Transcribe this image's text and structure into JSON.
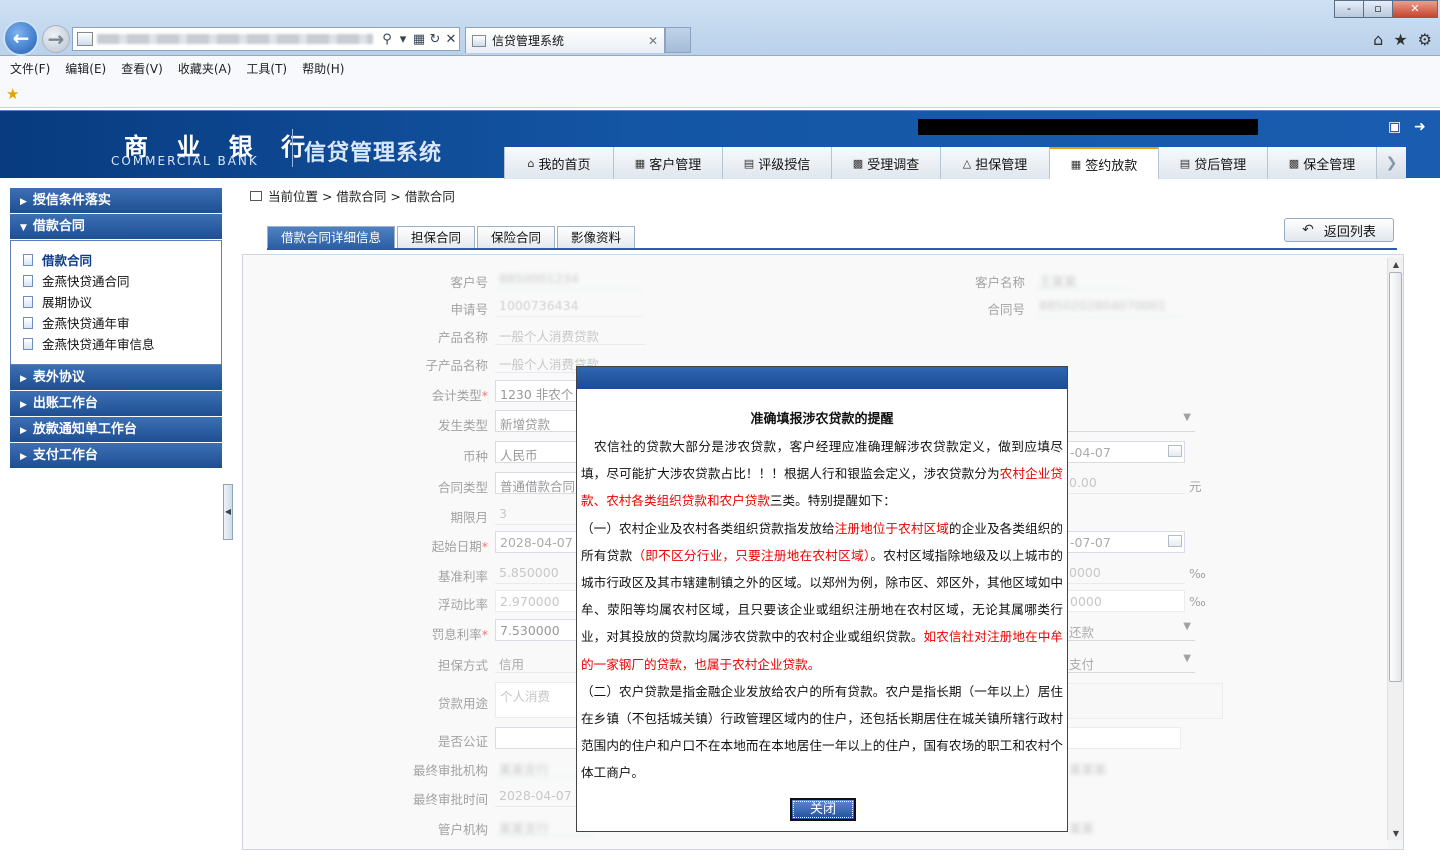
{
  "browser": {
    "tab_title": "信贷管理系统",
    "window_controls": [
      "-",
      "▫",
      "✕"
    ],
    "menu": [
      "文件(F)",
      "编辑(E)",
      "查看(V)",
      "收藏夹(A)",
      "工具(T)",
      "帮助(H)"
    ]
  },
  "header": {
    "bank_name_cn": "商 业 银 行",
    "bank_name_en": "COMMERCIAL BANK",
    "system_title": "信贷管理系统",
    "nav_tabs": [
      {
        "label": "我的首页",
        "icon": "home-icon"
      },
      {
        "label": "客户管理",
        "icon": "customer-icon"
      },
      {
        "label": "评级授信",
        "icon": "rating-icon"
      },
      {
        "label": "受理调查",
        "icon": "survey-icon"
      },
      {
        "label": "担保管理",
        "icon": "warning-icon"
      },
      {
        "label": "签约放款",
        "icon": "contract-icon",
        "active": true
      },
      {
        "label": "贷后管理",
        "icon": "postloan-icon"
      },
      {
        "label": "保全管理",
        "icon": "preserve-icon"
      }
    ]
  },
  "sidebar": {
    "groups": [
      {
        "label": "授信条件落实"
      },
      {
        "label": "借款合同",
        "expanded": true
      },
      {
        "label": "表外协议"
      },
      {
        "label": "出账工作台"
      },
      {
        "label": "放款通知单工作台"
      },
      {
        "label": "支付工作台"
      }
    ],
    "items": [
      "借款合同",
      "金燕快贷通合同",
      "展期协议",
      "金燕快贷通年审",
      "金燕快贷通年审信息"
    ]
  },
  "breadcrumb": "当前位置 > 借款合同 > 借款合同",
  "content_tabs": [
    "借款合同详细信息",
    "担保合同",
    "保险合同",
    "影像资料"
  ],
  "return_button": "返回列表",
  "form": {
    "customer_no_label": "客户号",
    "customer_no": "8850001234",
    "customer_name_label": "客户名称",
    "customer_name": "王某某",
    "apply_no_label": "申请号",
    "apply_no": "1000736434",
    "contract_no_label": "合同号",
    "contract_no": "8850202804070001",
    "product_label": "产品名称",
    "product": "一般个人消费贷款",
    "sub_product_label": "子产品名称",
    "sub_product": "一般个人消费贷款",
    "account_type_label": "会计类型",
    "account_type": "1230 非农个",
    "occur_type_label": "发生类型",
    "occur_type": "新增贷款",
    "currency_label": "币种",
    "currency": "人民币",
    "contract_type_label": "合同类型",
    "contract_type": "普通借款合同",
    "term_label": "期限月",
    "term": "3",
    "start_date_label": "起始日期",
    "start_date": "2028-04-07",
    "base_rate_label": "基准利率",
    "base_rate": "5.850000",
    "float_ratio_label": "浮动比率",
    "float_ratio": "2.970000",
    "penalty_rate_label": "罚息利率",
    "penalty_rate": "7.530000",
    "guarantee_label": "担保方式",
    "guarantee": "信用",
    "purpose_label": "贷款用途",
    "purpose": "个人消费",
    "notarized_label": "是否公证",
    "final_org_label": "最终审批机构",
    "final_org": "某某支行",
    "final_time_label": "最终审批时间",
    "final_time": "2028-04-07",
    "manage_org_label": "管户机构",
    "manage_org": "某某支行",
    "r_date1": "-04-07",
    "r_amount": "0.00",
    "r_amount_unit": "元",
    "r_date2": "-07-07",
    "r_rate1": "0000",
    "r_rate1_unit": "‰",
    "r_rate2": "0000",
    "r_rate2_unit": "‰",
    "r_repay": "还款",
    "r_pay": "支付",
    "r_blur1": "某某某",
    "r_blur2": "某某"
  },
  "modal": {
    "title": "准确填报涉农贷款的提醒",
    "p1_a": "农信社的贷款大部分是涉农贷款，客户经理应准确理解涉农贷款定义，做到应填尽填，尽可能扩大涉农贷款占比！！！根据人行和银监会定义，涉农贷款分为",
    "p1_red": "农村企业贷款、农村各类组织贷款和农户贷款",
    "p1_b": "三类。特别提醒如下：",
    "p2_a": "（一）农村企业及农村各类组织贷款指发放给",
    "p2_red1": "注册地位于农村区域",
    "p2_b": "的企业及各类组织的所有贷款",
    "p2_red2": "（即不区分行业，只要注册地在农村区域）",
    "p2_c": "。农村区域指除地级及以上城市的城市行政区及其市辖建制镇之外的区域。以郑州为例，除市区、郊区外，其他区域如中牟、荥阳等均属农村区域，且只要该企业或组织注册地在农村区域，无论其属哪类行业，对其投放的贷款均属涉农贷款中的农村企业或组织贷款。",
    "p2_red3": "如农信社对注册地在中牟的一家钢厂的贷款，也属于农村企业贷款。",
    "p3": "（二）农户贷款是指金融企业发放给农户的所有贷款。农户是指长期（一年以上）居住在乡镇（不包括城关镇）行政管理区域内的住户，还包括长期居住在城关镇所辖行政村范围内的住户和户口不在本地而在本地居住一年以上的住户，国有农场的职工和农村个体工商户。",
    "close": "关闭"
  }
}
